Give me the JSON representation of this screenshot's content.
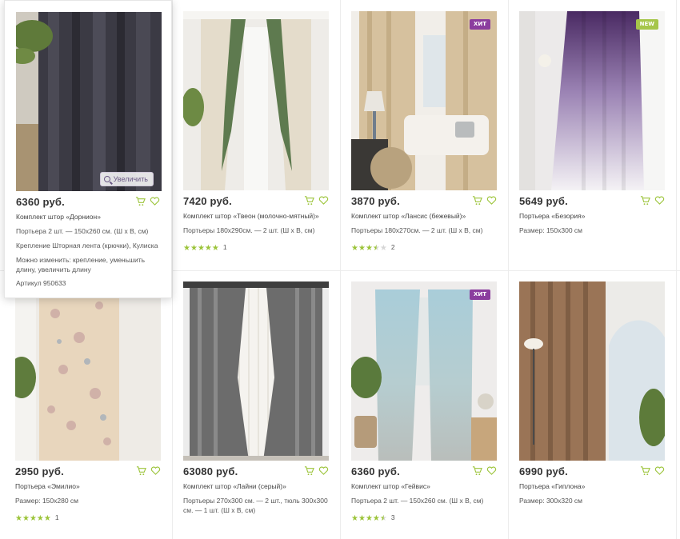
{
  "colors": {
    "hit_badge": "#8b3d9e",
    "new_badge": "#a6c64a",
    "star_on": "#9cc43a",
    "star_off": "#d6d6d6",
    "icon": "#9cc43a"
  },
  "products": [
    {
      "price": "6360 руб.",
      "name": "Комплект штор «Дорнион»",
      "size": "Портьера 2 шт. — 150x260 см. (Ш x В, см)",
      "zoom_label": "Увеличить",
      "fixing": "Крепление Шторная лента (крючки), Кулиска",
      "options": "Можно изменить: крепление, уменьшить длину, увеличить длину",
      "article": "Артикул 950633"
    },
    {
      "price": "7420 руб.",
      "name": "Комплект штор «Твеон (молочно-мятный)»",
      "size": "Портьеры 180x290см. — 2 шт. (Ш x В, см)",
      "rating": 5,
      "reviews": "1"
    },
    {
      "price": "3870 руб.",
      "name": "Комплект штор «Лансис (бежевый)»",
      "size": "Портьеры 180x270см. — 2 шт. (Ш x В, см)",
      "rating": 3.5,
      "reviews": "2",
      "badge": "ХИТ"
    },
    {
      "price": "5649 руб.",
      "name": "Портьера «Безория»",
      "size": "Размер: 150x300 см",
      "badge": "NEW"
    },
    {
      "price": "2950 руб.",
      "name": "Портьера «Эмилио»",
      "size": "Размер: 150x280 см",
      "rating": 5,
      "reviews": "1"
    },
    {
      "price": "63080 руб.",
      "name": "Комплект штор «Лайни (серый)»",
      "size": "Портьеры 270x300 см. — 2 шт., тюль 300x300 см. — 1 шт. (Ш x В, см)"
    },
    {
      "price": "6360 руб.",
      "name": "Комплект штор «Гейвис»",
      "size": "Портьера 2 шт. — 150x260 см. (Ш x В, см)",
      "rating": 4.5,
      "reviews": "3",
      "badge": "ХИТ"
    },
    {
      "price": "6990 руб.",
      "name": "Портьера «Гиплона»",
      "size": "Размер: 300x320 см"
    }
  ]
}
